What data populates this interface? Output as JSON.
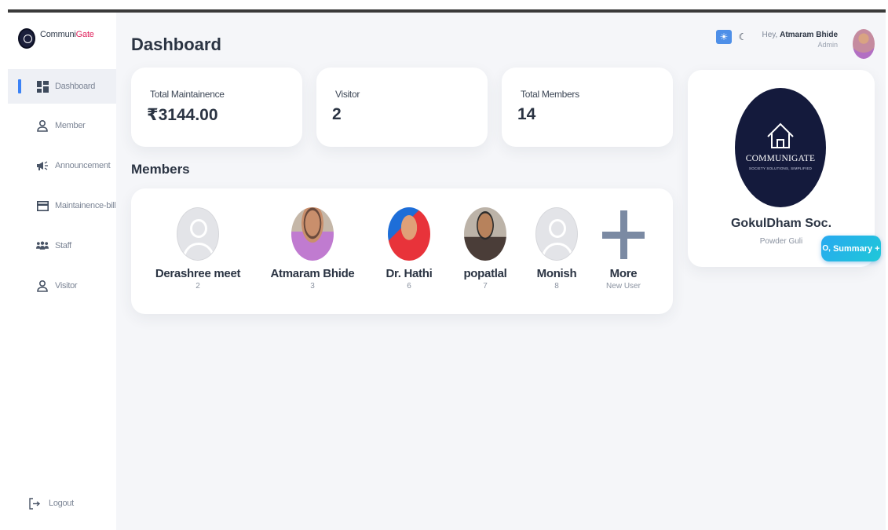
{
  "brand": {
    "name_part1": "Communi",
    "name_part2": "Gate"
  },
  "sidebar": {
    "items": [
      {
        "label": "Dashboard",
        "icon": "dashboard-icon",
        "active": true
      },
      {
        "label": "Member",
        "icon": "user-icon"
      },
      {
        "label": "Announcement",
        "icon": "megaphone-icon"
      },
      {
        "label": "Maintainence-bill",
        "icon": "bill-icon"
      },
      {
        "label": "Staff",
        "icon": "group-icon"
      },
      {
        "label": "Visitor",
        "icon": "user-icon"
      }
    ],
    "logout_label": "Logout"
  },
  "header": {
    "title": "Dashboard",
    "greeting_prefix": "Hey,",
    "user_name": "Atmaram Bhide",
    "user_role": "Admin",
    "theme": {
      "light_icon": "sun-icon",
      "dark_icon": "moon-icon"
    }
  },
  "stats": [
    {
      "label": "Total Maintainence",
      "value": "₹3144.00"
    },
    {
      "label": "Visitor",
      "value": "2"
    },
    {
      "label": "Total Members",
      "value": "14"
    }
  ],
  "members_section": {
    "title": "Members",
    "members": [
      {
        "name": "Derashree meet",
        "id": "2"
      },
      {
        "name": "Atmaram Bhide",
        "id": "3"
      },
      {
        "name": "Dr. Hathi",
        "id": "6"
      },
      {
        "name": "popatlal",
        "id": "7"
      },
      {
        "name": "Monish",
        "id": "8"
      }
    ],
    "more": {
      "label": "More",
      "sub": "New User"
    }
  },
  "society": {
    "logo_name": "COMMUNIGATE",
    "logo_tagline": "SOCIETY SOLUTIONS, SIMPLIFIED",
    "name": "GokulDham Soc.",
    "address": "Powder Guli"
  },
  "summary_button": {
    "label": "Summary +"
  },
  "colors": {
    "accent": "#3b82f6",
    "brand_accent": "#e0245e",
    "logo_bg": "#141a3c",
    "summary_gradient": [
      "#28a9f0",
      "#1fc8d8"
    ]
  }
}
